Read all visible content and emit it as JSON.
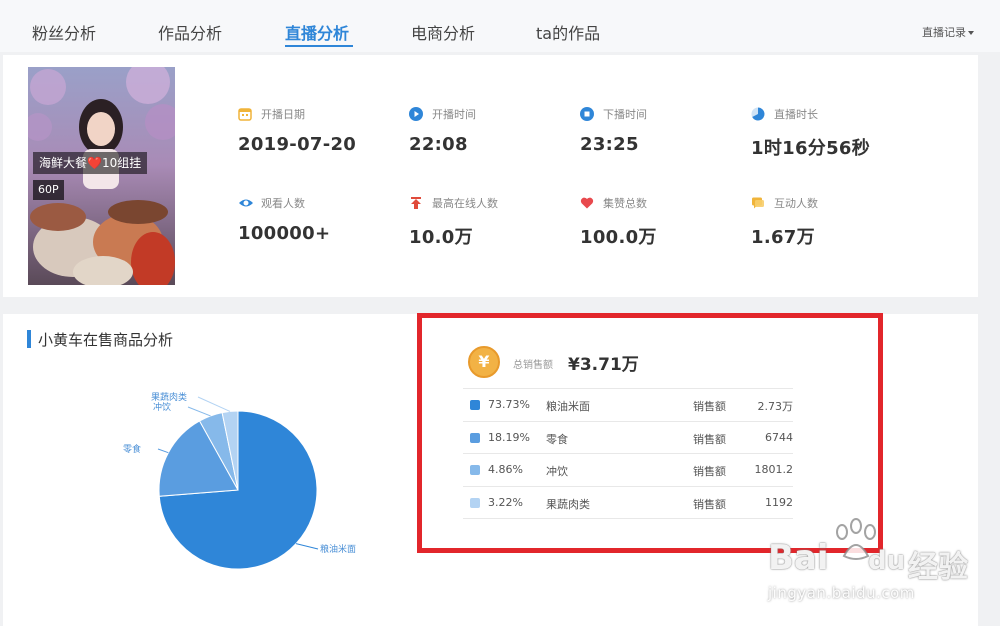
{
  "tabs": [
    {
      "label": "粉丝分析"
    },
    {
      "label": "作品分析"
    },
    {
      "label": "直播分析",
      "active": true
    },
    {
      "label": "电商分析"
    },
    {
      "label": "ta的作品"
    }
  ],
  "record_dropdown": {
    "label": "直播记录"
  },
  "thumbnail": {
    "title": "海鲜大餐❤️10组挂",
    "tag": "60P"
  },
  "stats": [
    {
      "label": "开播日期",
      "value": "2019-07-20",
      "icon": "calendar-icon",
      "color": "#f0b43a"
    },
    {
      "label": "开播时间",
      "value": "22:08",
      "icon": "play-icon",
      "color": "#2f86d8"
    },
    {
      "label": "下播时间",
      "value": "23:25",
      "icon": "stop-icon",
      "color": "#2f86d8"
    },
    {
      "label": "直播时长",
      "value": "1时16分56秒",
      "icon": "duration-icon",
      "color": "#2f86d8"
    },
    {
      "label": "观看人数",
      "value": "100000+",
      "icon": "eye-icon",
      "color": "#2f86d8"
    },
    {
      "label": "最高在线人数",
      "value": "10.0万",
      "icon": "arrow-up-icon",
      "color": "#e04b3b"
    },
    {
      "label": "集赞总数",
      "value": "100.0万",
      "icon": "heart-icon",
      "color": "#e8494d"
    },
    {
      "label": "互动人数",
      "value": "1.67万",
      "icon": "chat-icon",
      "color": "#f0b43a"
    }
  ],
  "section": {
    "title": "小黄车在售商品分析"
  },
  "sales": {
    "currency_symbol": "¥",
    "total_label": "总销售额",
    "total_value": "¥3.71万",
    "rows": [
      {
        "pct": "73.73%",
        "name": "粮油米面",
        "label": "销售额",
        "amount": "2.73万",
        "color": "#2f86d8"
      },
      {
        "pct": "18.19%",
        "name": "零食",
        "label": "销售额",
        "amount": "6744",
        "color": "#5a9de0"
      },
      {
        "pct": "4.86%",
        "name": "冲饮",
        "label": "销售额",
        "amount": "1801.2",
        "color": "#86b9ea"
      },
      {
        "pct": "3.22%",
        "name": "果蔬肉类",
        "label": "销售额",
        "amount": "1192",
        "color": "#b3d3f3"
      }
    ]
  },
  "chart_data": {
    "type": "pie",
    "categories": [
      "粮油米面",
      "零食",
      "冲饮",
      "果蔬肉类"
    ],
    "values": [
      73.73,
      18.19,
      4.86,
      3.22
    ],
    "colors": [
      "#2f86d8",
      "#5a9de0",
      "#86b9ea",
      "#b3d3f3"
    ],
    "title": ""
  },
  "watermark": {
    "brand_left": "Bai",
    "brand_right": "du",
    "brand_cn": "经验",
    "url": "jingyan.baidu.com"
  }
}
